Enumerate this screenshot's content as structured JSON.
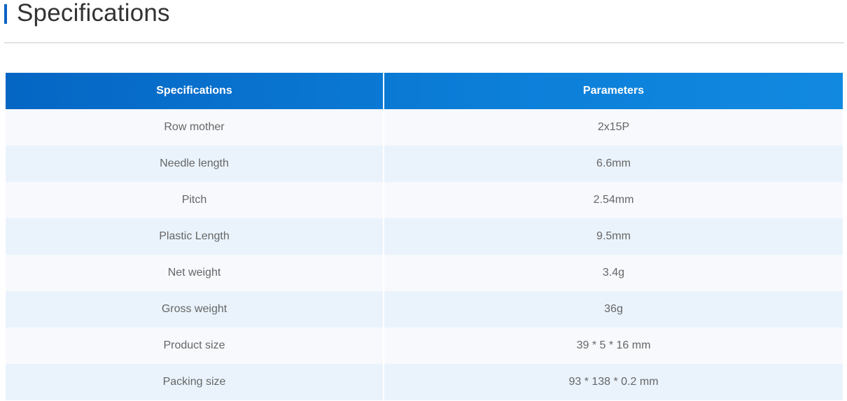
{
  "section": {
    "title": "Specifications"
  },
  "table": {
    "headers": [
      "Specifications",
      "Parameters"
    ],
    "rows": [
      [
        "Row mother",
        "2x15P"
      ],
      [
        "Needle length",
        "6.6mm"
      ],
      [
        "Pitch",
        "2.54mm"
      ],
      [
        "Plastic Length",
        "9.5mm"
      ],
      [
        "Net weight",
        "3.4g"
      ],
      [
        "Gross weight",
        "36g"
      ],
      [
        "Product size",
        "39 * 5 * 16 mm"
      ],
      [
        "Packing size",
        "93 * 138 * 0.2 mm"
      ]
    ]
  },
  "colors": {
    "accent": "#0a62c4",
    "header_start": "#0566c4",
    "header_end": "#1289e0",
    "row_light": "#f7f9fc",
    "row_alt": "#eaf3fc",
    "title_text": "#333333",
    "cell_text": "#666666"
  }
}
